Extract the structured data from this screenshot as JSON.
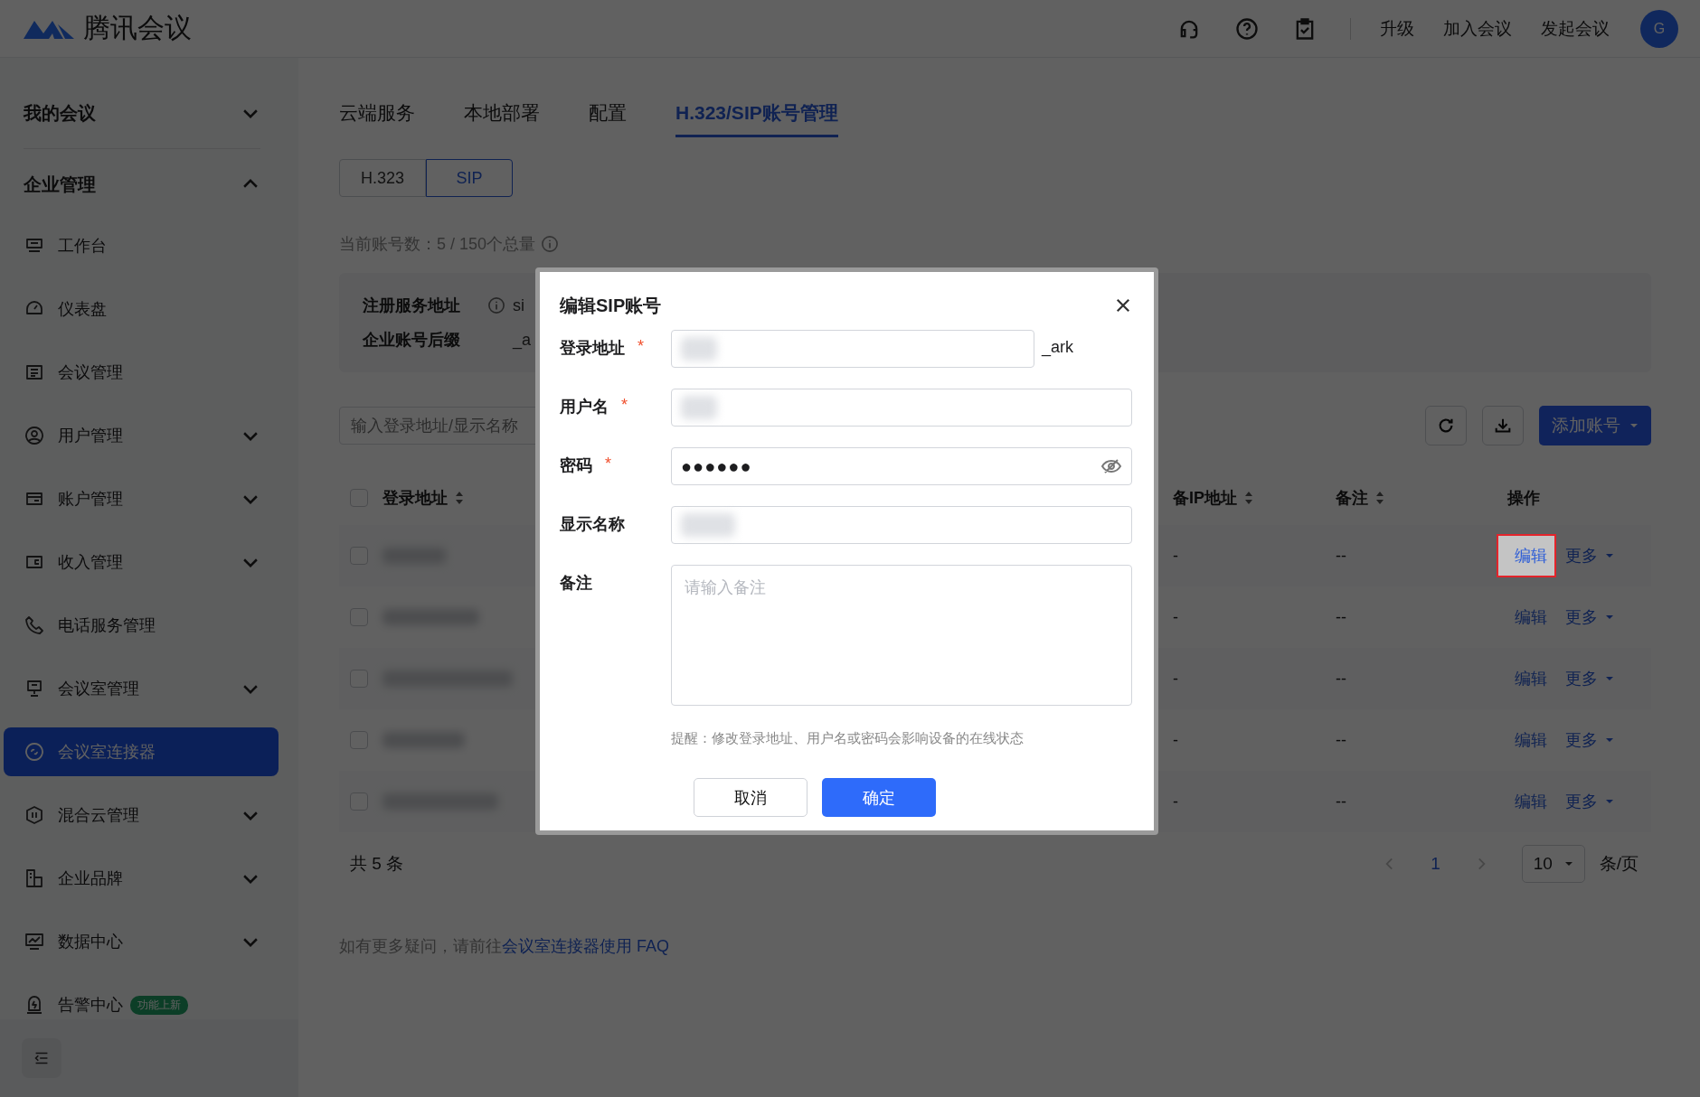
{
  "header": {
    "logo": "腾讯会议",
    "links": [
      "升级",
      "加入会议",
      "发起会议"
    ],
    "avatar": "G"
  },
  "sidebar": {
    "sections": [
      {
        "label": "我的会议",
        "expanded": false
      },
      {
        "label": "企业管理",
        "expanded": true
      }
    ],
    "items": [
      {
        "label": "工作台",
        "kind": "link",
        "selected": false
      },
      {
        "label": "仪表盘",
        "kind": "link",
        "selected": false
      },
      {
        "label": "会议管理",
        "kind": "link",
        "selected": false
      },
      {
        "label": "用户管理",
        "kind": "group",
        "expanded": false,
        "selected": false
      },
      {
        "label": "账户管理",
        "kind": "group",
        "expanded": false,
        "selected": false
      },
      {
        "label": "收入管理",
        "kind": "group",
        "expanded": false,
        "selected": false
      },
      {
        "label": "电话服务管理",
        "kind": "link",
        "selected": false
      },
      {
        "label": "会议室管理",
        "kind": "group",
        "expanded": false,
        "selected": false
      },
      {
        "label": "会议室连接器",
        "kind": "link",
        "selected": true
      },
      {
        "label": "混合云管理",
        "kind": "group",
        "expanded": false,
        "selected": false
      },
      {
        "label": "企业品牌",
        "kind": "group",
        "expanded": false,
        "selected": false
      },
      {
        "label": "数据中心",
        "kind": "group",
        "expanded": false,
        "selected": false
      },
      {
        "label": "告警中心",
        "kind": "link",
        "selected": false,
        "badge": "功能上新"
      }
    ]
  },
  "tabs": [
    {
      "label": "云端服务",
      "selected": false
    },
    {
      "label": "本地部署",
      "selected": false
    },
    {
      "label": "配置",
      "selected": false
    },
    {
      "label": "H.323/SIP账号管理",
      "selected": true
    }
  ],
  "segments": [
    {
      "label": "H.323",
      "selected": false
    },
    {
      "label": "SIP",
      "selected": true
    }
  ],
  "count": "当前账号数：5 / 150个总量",
  "info": [
    {
      "label": "注册服务地址",
      "info": true,
      "value": "si"
    },
    {
      "label": "企业账号后缀",
      "info": false,
      "value": "_a"
    }
  ],
  "search": {
    "placeholder": "输入登录地址/显示名称"
  },
  "add_button": "添加账号",
  "table": {
    "select_all": false,
    "columns": [
      {
        "label": "登录地址",
        "sortable": true
      },
      {
        "label": "备IP地址",
        "sortable": true
      },
      {
        "label": "备注",
        "sortable": true
      },
      {
        "label": "操作",
        "sortable": false
      }
    ],
    "rows": [
      {
        "checked": false,
        "ip": "-",
        "note": "--",
        "edit": "编辑",
        "more": "更多",
        "highlighted": true
      },
      {
        "checked": false,
        "ip": "-",
        "note": "--",
        "edit": "编辑",
        "more": "更多",
        "highlighted": false
      },
      {
        "checked": false,
        "ip": "-",
        "note": "--",
        "edit": "编辑",
        "more": "更多",
        "highlighted": false
      },
      {
        "checked": false,
        "ip": "-",
        "note": "--",
        "edit": "编辑",
        "more": "更多",
        "highlighted": false
      },
      {
        "checked": false,
        "ip": "-",
        "note": "--",
        "edit": "编辑",
        "more": "更多",
        "highlighted": false
      }
    ]
  },
  "pagination": {
    "total": "共 5 条",
    "pages": [
      {
        "label": "1",
        "selected": true
      }
    ],
    "page_size": "10",
    "unit": "条/页"
  },
  "footer": {
    "text": "如有更多疑问，请前往",
    "link": "会议室连接器使用 FAQ"
  },
  "dialog": {
    "title": "编辑SIP账号",
    "fields": [
      {
        "label": "登录地址",
        "required": true,
        "kind": "text",
        "suffix": "_ark"
      },
      {
        "label": "用户名",
        "required": true,
        "kind": "text"
      },
      {
        "label": "密码",
        "required": true,
        "kind": "password",
        "value": "●●●●●●"
      },
      {
        "label": "显示名称",
        "required": false,
        "kind": "text"
      },
      {
        "label": "备注",
        "required": false,
        "kind": "textarea",
        "placeholder": "请输入备注"
      }
    ],
    "required_mark": "*",
    "hint": "提醒：修改登录地址、用户名或密码会影响设备的在线状态",
    "cancel": "取消",
    "confirm": "确定"
  }
}
